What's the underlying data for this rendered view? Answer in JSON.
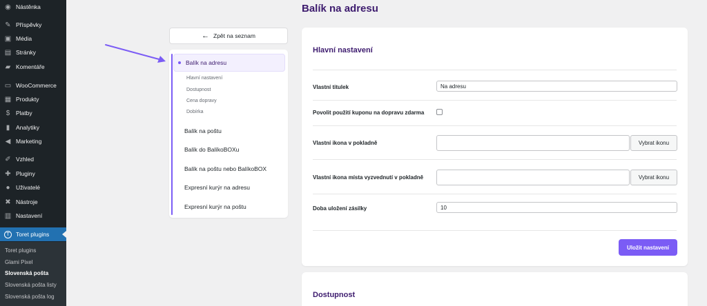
{
  "admin_menu": {
    "items": [
      {
        "label": "Nástěnka",
        "icon": "dashboard-icon",
        "glyph": "◉"
      },
      {
        "label": "Příspěvky",
        "icon": "pin-icon",
        "glyph": "✎"
      },
      {
        "label": "Média",
        "icon": "media-icon",
        "glyph": "▣"
      },
      {
        "label": "Stránky",
        "icon": "pages-icon",
        "glyph": "▤"
      },
      {
        "label": "Komentáře",
        "icon": "comments-icon",
        "glyph": "▰"
      },
      {
        "label": "WooCommerce",
        "icon": "woocommerce-icon",
        "glyph": "▭"
      },
      {
        "label": "Produkty",
        "icon": "products-icon",
        "glyph": "▦"
      },
      {
        "label": "Platby",
        "icon": "payments-icon",
        "glyph": "$"
      },
      {
        "label": "Analytiky",
        "icon": "analytics-icon",
        "glyph": "▮"
      },
      {
        "label": "Marketing",
        "icon": "marketing-icon",
        "glyph": "◀"
      },
      {
        "label": "Vzhled",
        "icon": "appearance-icon",
        "glyph": "✐"
      },
      {
        "label": "Pluginy",
        "icon": "plugins-icon",
        "glyph": "✚"
      },
      {
        "label": "Uživatelé",
        "icon": "users-icon",
        "glyph": "●"
      },
      {
        "label": "Nástroje",
        "icon": "tools-icon",
        "glyph": "✖"
      },
      {
        "label": "Nastavení",
        "icon": "settings-icon",
        "glyph": "▥"
      },
      {
        "label": "Toret plugins",
        "icon": "toret-icon",
        "glyph": "T"
      }
    ],
    "submenu": [
      "Toret plugins",
      "Glami Pixel",
      "Slovenská pošta",
      "Slovenská pošta listy",
      "Slovenská pošta log"
    ]
  },
  "page_title": "Balík na adresu",
  "back_button": "Zpět na seznam",
  "nav": {
    "active": "Balík na adresu",
    "subitems": [
      "Hlavní nastavení",
      "Dostupnost",
      "Cena dopravy",
      "Dobírka"
    ],
    "items": [
      "Balík na poštu",
      "Balík do BalíkoBOXu",
      "Balík na poštu nebo BalíkoBOX",
      "Expresní kurýr na adresu",
      "Expresní kurýr na poštu"
    ]
  },
  "main": {
    "section_title": "Hlavní nastavení",
    "fields": {
      "title_label": "Vlastní titulek",
      "title_value": "Na adresu",
      "coupon_label": "Povolit použití kuponu na dopravu zdarma",
      "icon_label": "Vlastní ikona v pokladně",
      "pickup_icon_label": "Vlastní ikona místa vyzvednutí v pokladně",
      "choose_icon": "Vybrat ikonu",
      "storage_label": "Doba uložení zásilky",
      "storage_value": "10"
    },
    "save_button": "Uložit nastavení"
  },
  "second_section_title": "Dostupnost",
  "colors": {
    "accent": "#7b5cf5",
    "heading": "#3d1b6e",
    "admin_bar": "#1d2327",
    "admin_active": "#2271b1"
  }
}
